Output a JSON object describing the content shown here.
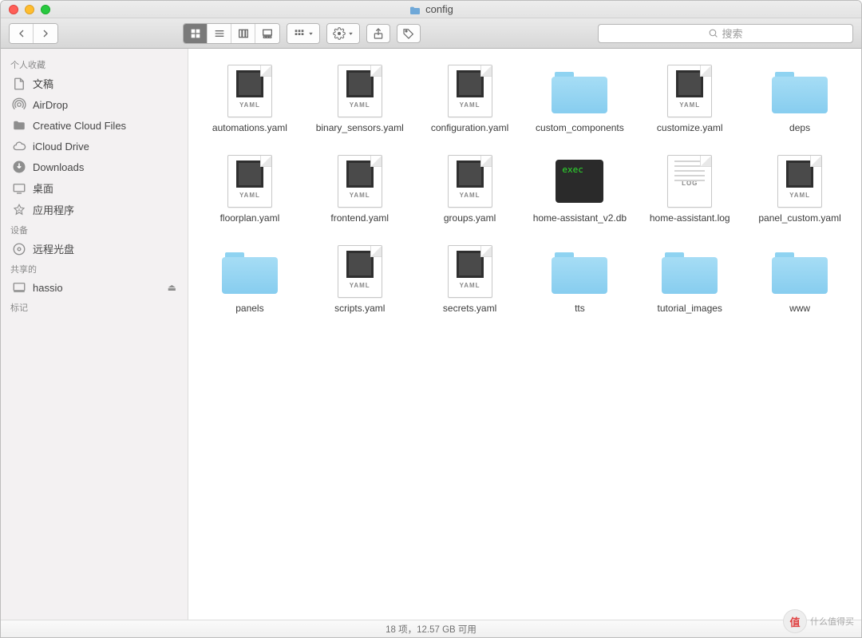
{
  "window": {
    "title": "config"
  },
  "search": {
    "placeholder": "搜索"
  },
  "sidebar": {
    "groups": [
      {
        "label": "个人收藏",
        "items": [
          {
            "icon": "doc-icon",
            "label": "文稿"
          },
          {
            "icon": "airdrop-icon",
            "label": "AirDrop"
          },
          {
            "icon": "folder-side-icon",
            "label": "Creative Cloud Files"
          },
          {
            "icon": "cloud-icon",
            "label": "iCloud Drive"
          },
          {
            "icon": "downloads-icon",
            "label": "Downloads"
          },
          {
            "icon": "desktop-icon",
            "label": "桌面"
          },
          {
            "icon": "apps-icon",
            "label": "应用程序"
          }
        ]
      },
      {
        "label": "设备",
        "items": [
          {
            "icon": "disc-icon",
            "label": "远程光盘"
          }
        ]
      },
      {
        "label": "共享的",
        "items": [
          {
            "icon": "server-icon",
            "label": "hassio",
            "eject": true
          }
        ]
      },
      {
        "label": "标记",
        "items": []
      }
    ]
  },
  "files": [
    {
      "type": "yaml",
      "tag": "YAML",
      "name": "automations.yaml"
    },
    {
      "type": "yaml",
      "tag": "YAML",
      "name": "binary_sensors.yaml"
    },
    {
      "type": "yaml",
      "tag": "YAML",
      "name": "configuration.yaml"
    },
    {
      "type": "folder",
      "name": "custom_components"
    },
    {
      "type": "yaml",
      "tag": "YAML",
      "name": "customize.yaml"
    },
    {
      "type": "folder",
      "name": "deps"
    },
    {
      "type": "yaml",
      "tag": "YAML",
      "name": "floorplan.yaml"
    },
    {
      "type": "yaml",
      "tag": "YAML",
      "name": "frontend.yaml"
    },
    {
      "type": "yaml",
      "tag": "YAML",
      "name": "groups.yaml"
    },
    {
      "type": "exec",
      "tag": "exec",
      "name": "home-assistant_v2.db"
    },
    {
      "type": "log",
      "tag": "LOG",
      "name": "home-assistant.log"
    },
    {
      "type": "yaml",
      "tag": "YAML",
      "name": "panel_custom.yaml"
    },
    {
      "type": "folder",
      "name": "panels"
    },
    {
      "type": "yaml",
      "tag": "YAML",
      "name": "scripts.yaml"
    },
    {
      "type": "yaml",
      "tag": "YAML",
      "name": "secrets.yaml"
    },
    {
      "type": "folder",
      "name": "tts"
    },
    {
      "type": "folder",
      "name": "tutorial_images"
    },
    {
      "type": "folder",
      "name": "www"
    }
  ],
  "status": {
    "text": "18 项，12.57 GB 可用"
  },
  "watermark": "什么值得买"
}
